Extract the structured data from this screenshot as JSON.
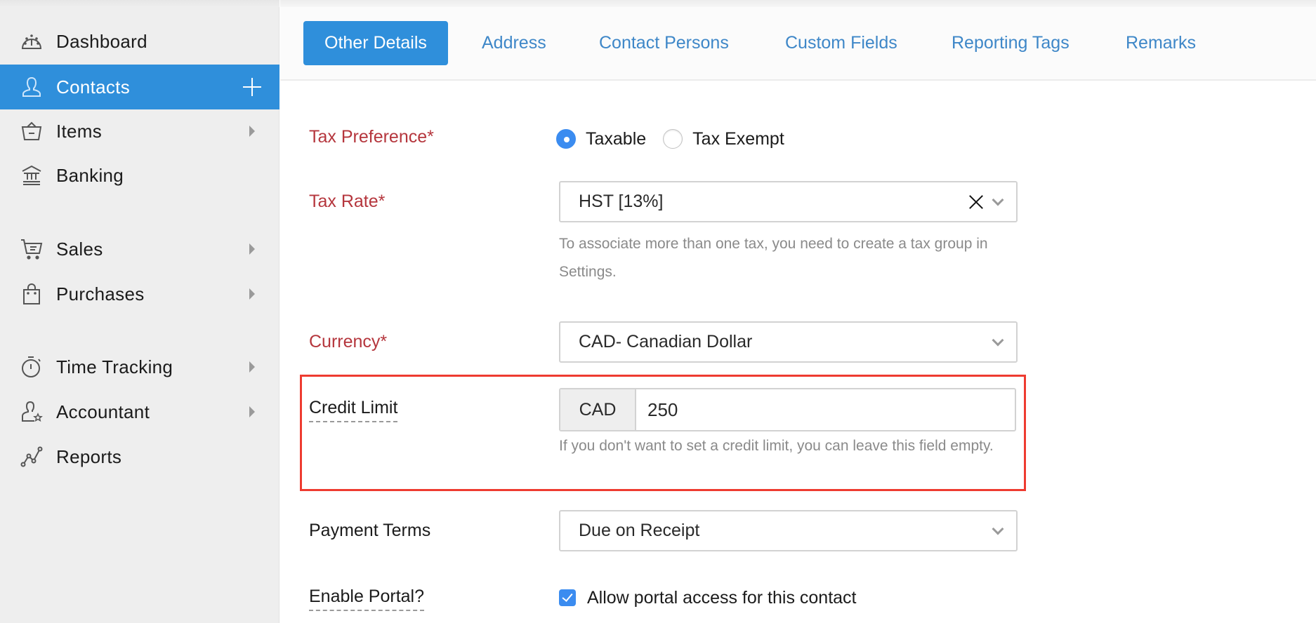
{
  "sidebar": {
    "items": [
      {
        "label": "Dashboard",
        "icon": "dashboard-gauge-icon",
        "active": false,
        "has_submenu": false
      },
      {
        "label": "Contacts",
        "icon": "user-icon",
        "active": true,
        "has_submenu": false,
        "action_icon": "plus-icon"
      },
      {
        "label": "Items",
        "icon": "basket-icon",
        "active": false,
        "has_submenu": true
      },
      {
        "label": "Banking",
        "icon": "bank-icon",
        "active": false,
        "has_submenu": false
      },
      {
        "label": "Sales",
        "icon": "cart-icon",
        "active": false,
        "has_submenu": true
      },
      {
        "label": "Purchases",
        "icon": "shopping-bag-icon",
        "active": false,
        "has_submenu": true
      },
      {
        "label": "Time Tracking",
        "icon": "stopwatch-icon",
        "active": false,
        "has_submenu": true
      },
      {
        "label": "Accountant",
        "icon": "user-star-icon",
        "active": false,
        "has_submenu": true
      },
      {
        "label": "Reports",
        "icon": "line-chart-icon",
        "active": false,
        "has_submenu": false
      }
    ]
  },
  "tabs": [
    {
      "label": "Other Details",
      "active": true
    },
    {
      "label": "Address",
      "active": false
    },
    {
      "label": "Contact Persons",
      "active": false
    },
    {
      "label": "Custom Fields",
      "active": false
    },
    {
      "label": "Reporting Tags",
      "active": false
    },
    {
      "label": "Remarks",
      "active": false
    }
  ],
  "form": {
    "tax_preference": {
      "label": "Tax Preference*",
      "options": [
        {
          "label": "Taxable",
          "checked": true
        },
        {
          "label": "Tax Exempt",
          "checked": false
        }
      ]
    },
    "tax_rate": {
      "label": "Tax Rate*",
      "value": "HST [13%]",
      "help": "To associate more than one tax, you need to create a tax group in Settings."
    },
    "currency": {
      "label": "Currency*",
      "value": "CAD- Canadian Dollar"
    },
    "credit_limit": {
      "label": "Credit Limit",
      "currency_addon": "CAD",
      "value": "250",
      "help": "If you don't want to set a credit limit, you can leave this field empty.",
      "highlight_color": "#ee3b30"
    },
    "payment_terms": {
      "label": "Payment Terms",
      "value": "Due on Receipt"
    },
    "enable_portal": {
      "label": "Enable Portal?",
      "checkbox_label": "Allow portal access for this contact",
      "checked": true
    }
  },
  "colors": {
    "accent": "#2f8fdb",
    "tab_link": "#3e87c8",
    "required_label": "#b5363d",
    "radio_checkbox": "#3b8cf0"
  }
}
